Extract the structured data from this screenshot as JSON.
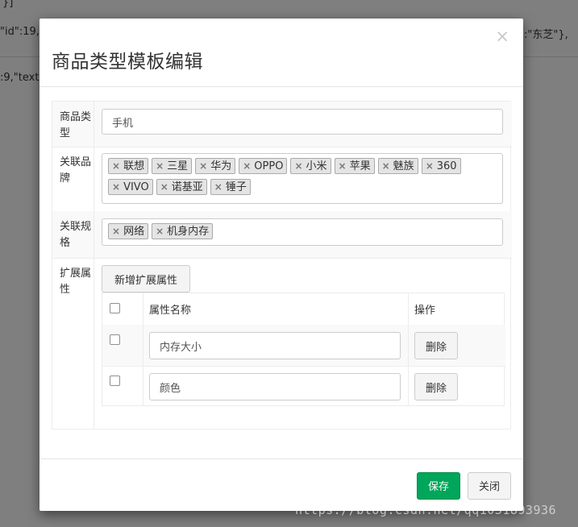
{
  "background": {
    "line1": "}]",
    "line2_left": "\"id\":19,\"",
    "line2_right": ":\"东芝\"},",
    "line3": ":9,\"text\""
  },
  "modal": {
    "title": "商品类型模板编辑",
    "close_symbol": "×"
  },
  "form": {
    "type_label": "商品类型",
    "type_value": "手机",
    "brand_label": "关联品牌",
    "brands": [
      "联想",
      "三星",
      "华为",
      "OPPO",
      "小米",
      "苹果",
      "魅族",
      "360",
      "VIVO",
      "诺基亚",
      "锤子"
    ],
    "spec_label": "关联规格",
    "specs": [
      "网络",
      "机身内存"
    ],
    "ext_label": "扩展属性",
    "add_ext_button": "新增扩展属性",
    "ext_table": {
      "header_name": "属性名称",
      "header_action": "操作",
      "rows": [
        {
          "name": "内存大小",
          "delete_label": "删除"
        },
        {
          "name": "颜色",
          "delete_label": "删除"
        }
      ]
    }
  },
  "footer": {
    "save_label": "保存",
    "close_label": "关闭"
  },
  "watermark": "https://blog.csdn.net/qq1031893936",
  "colors": {
    "save_button": "#00a65a",
    "backdrop": "rgba(0,0,0,0.5)"
  }
}
